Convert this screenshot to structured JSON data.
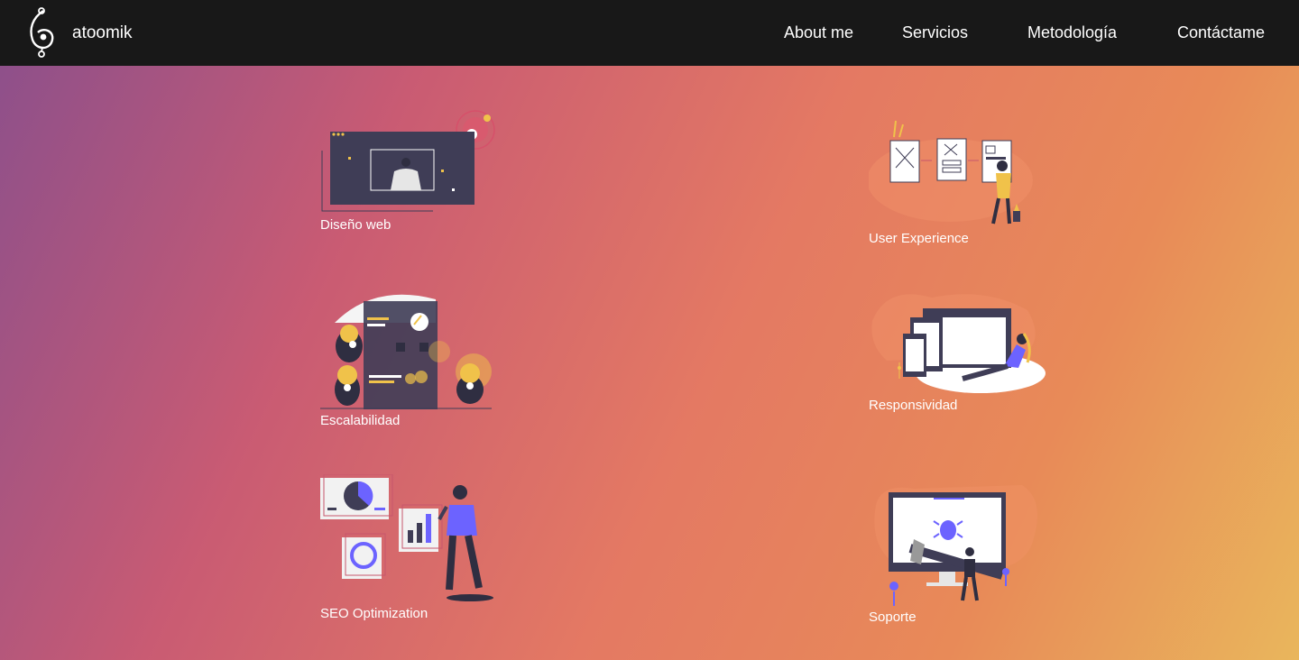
{
  "brand": {
    "name": "atoomik",
    "logo_icon": "atom-spiral-icon"
  },
  "nav": [
    {
      "label": "About me"
    },
    {
      "label": "Servicios"
    },
    {
      "label": "Metodología"
    },
    {
      "label": "Contáctame"
    }
  ],
  "services": {
    "left": [
      {
        "label": "Diseño web",
        "illustration": "web-design-illustration"
      },
      {
        "label": "Escalabilidad",
        "illustration": "scalability-illustration"
      },
      {
        "label": "SEO Optimization",
        "illustration": "seo-illustration"
      }
    ],
    "right": [
      {
        "label": "User Experience",
        "illustration": "wireframe-illustration"
      },
      {
        "label": "Responsividad",
        "illustration": "devices-illustration"
      },
      {
        "label": "Soporte",
        "illustration": "bug-fix-illustration"
      }
    ]
  },
  "colors": {
    "topbar": "#181818",
    "gradient_start": "#8a4f8c",
    "gradient_end": "#e9b65c",
    "accent_purple": "#6c63ff",
    "accent_yellow": "#f0c24a",
    "dark_navy": "#3f3d56"
  }
}
